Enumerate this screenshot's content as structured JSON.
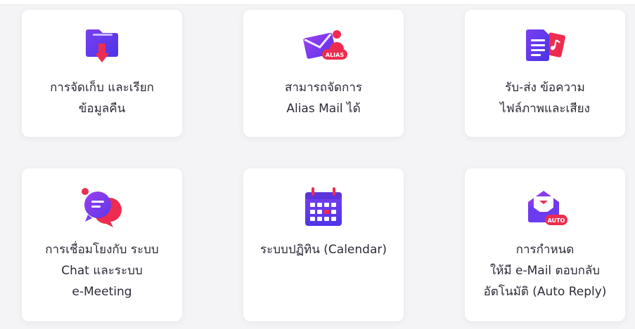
{
  "features": [
    {
      "id": "archive",
      "icon": "folder-download-icon",
      "lines": [
        "การจัดเก็บ และเรียก",
        "ข้อมูลคืน"
      ]
    },
    {
      "id": "alias",
      "icon": "alias-mail-icon",
      "badge": "ALIAS",
      "lines": [
        "สามารถจัดการ",
        "Alias Mail ได้"
      ]
    },
    {
      "id": "media",
      "icon": "document-music-icon",
      "lines": [
        "รับ-ส่ง ข้อความ",
        "ไฟล์ภาพและเสียง"
      ]
    },
    {
      "id": "chat",
      "icon": "chat-bubbles-icon",
      "lines": [
        "การเชื่อมโยงกับ ระบบ",
        "Chat และระบบ",
        "e-Meeting"
      ]
    },
    {
      "id": "calendar",
      "icon": "calendar-icon",
      "lines": [
        "ระบบปฏิทิน (Calendar)"
      ]
    },
    {
      "id": "autoreply",
      "icon": "auto-reply-mail-icon",
      "badge": "AUTO",
      "lines": [
        "การกำหนด",
        "ให้มี e-Mail ตอบกลับ",
        "อัตโนมัติ (Auto Reply)"
      ]
    }
  ],
  "colors": {
    "purple": "#6a3df0",
    "violet": "#8b3ff0",
    "pink": "#e8375d",
    "red": "#ee2c4f"
  }
}
